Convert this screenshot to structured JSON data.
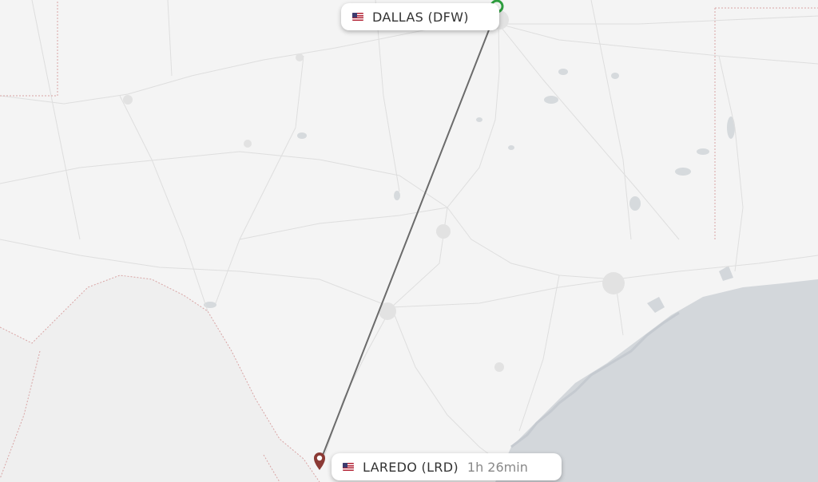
{
  "origin": {
    "city_label": "DALLAS (DFW)",
    "flag": "us-flag-icon",
    "marker_color": "#2e9d3e"
  },
  "destination": {
    "city_label": "LAREDO (LRD)",
    "flag": "us-flag-icon",
    "duration": "1h 26min",
    "marker_color": "#8b3a35"
  },
  "colors": {
    "land": "#f4f4f4",
    "water": "#d3d7db",
    "route_line": "#6b6b6b",
    "roads": "#dcdcdc",
    "borders": "#c88a8a"
  }
}
